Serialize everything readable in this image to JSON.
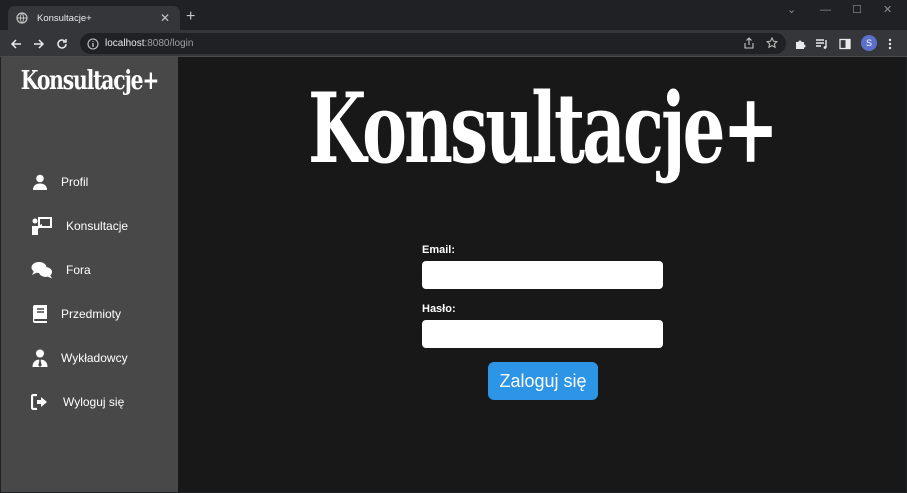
{
  "browser": {
    "tab": {
      "title": "Konsultacje+",
      "favicon": "globe-icon"
    },
    "url": {
      "host": "localhost",
      "rest": ":8080/login"
    },
    "profile_initial": "S"
  },
  "sidebar": {
    "logo": "Konsultacje+",
    "items": [
      {
        "label": "Profil",
        "icon": "user-icon"
      },
      {
        "label": "Konsultacje",
        "icon": "teacher-board-icon"
      },
      {
        "label": "Fora",
        "icon": "comments-icon"
      },
      {
        "label": "Przedmioty",
        "icon": "book-icon"
      },
      {
        "label": "Wykładowcy",
        "icon": "user-tie-icon"
      },
      {
        "label": "Wyloguj się",
        "icon": "sign-out-icon"
      }
    ]
  },
  "main": {
    "title": "Konsultacje+",
    "email_label": "Email:",
    "email_value": "",
    "password_label": "Hasło:",
    "password_value": "",
    "submit_label": "Zaloguj się"
  },
  "colors": {
    "sidebar_bg": "#484848",
    "main_bg": "#181818",
    "button_bg": "#2d95e6"
  }
}
